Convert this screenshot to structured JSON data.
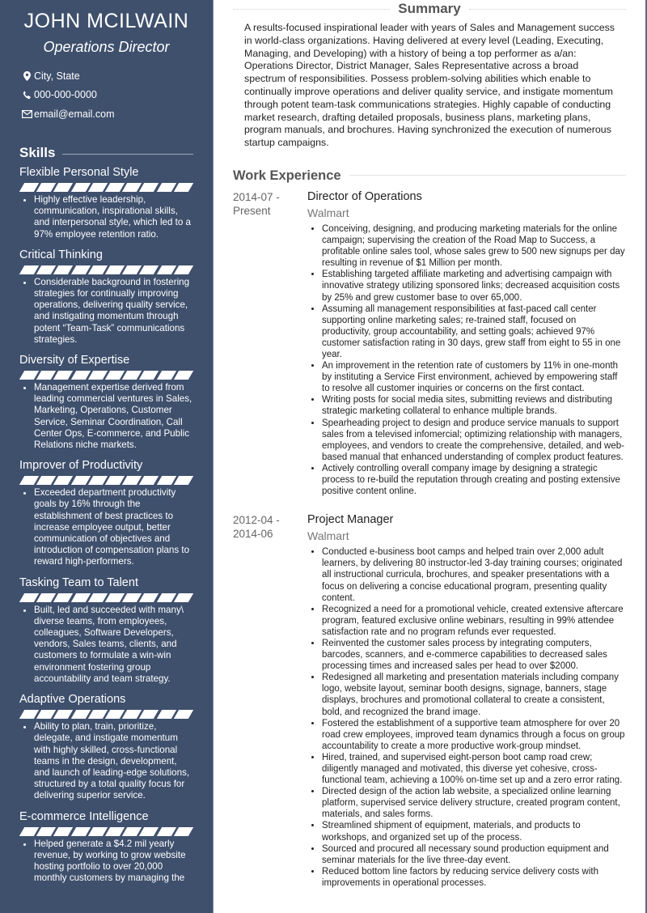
{
  "header": {
    "name": "JOHN MCILWAIN",
    "role": "Operations Director"
  },
  "contact": [
    {
      "icon": "location-pin-icon",
      "text": "City, State"
    },
    {
      "icon": "phone-icon",
      "text": "000-000-0000"
    },
    {
      "icon": "envelope-icon",
      "text": "email@email.com"
    }
  ],
  "skills": {
    "heading": "Skills",
    "bar_segments": 10,
    "items": [
      {
        "name": "Flexible Personal Style",
        "level": 10,
        "bullets": [
          "Highly effective leadership, communication, inspirational skills, and interpersonal style, which led to a 97% employee retention ratio."
        ]
      },
      {
        "name": "Critical Thinking",
        "level": 10,
        "bullets": [
          "Considerable background in fostering strategies for continually improving operations, delivering quality service, and instigating momentum through potent “Team-Task” communications strategies."
        ]
      },
      {
        "name": "Diversity of Expertise",
        "level": 10,
        "bullets": [
          "Management expertise derived from leading commercial ventures in Sales, Marketing, Operations, Customer Service, Seminar Coordination, Call Center Ops, E-commerce, and Public Relations niche markets."
        ]
      },
      {
        "name": "Improver of Productivity",
        "level": 10,
        "bullets": [
          "Exceeded department productivity goals by 16% through the establishment of best practices to increase employee output, better communication of objectives and introduction of compensation plans to reward high-performers."
        ]
      },
      {
        "name": "Tasking Team to Talent",
        "level": 10,
        "bullets": [
          "Built, led and succeeded with many\\ diverse teams, from employees, colleagues, Software Developers, vendors, Sales teams, clients, and customers to formulate a win-win environment fostering group accountability and team strategy."
        ]
      },
      {
        "name": "Adaptive Operations",
        "level": 10,
        "bullets": [
          "Ability to plan, train, prioritize, delegate, and instigate momentum with highly skilled, cross-functional teams in the design, development, and launch of leading-edge solutions, structured by a total quality focus for delivering superior service."
        ]
      },
      {
        "name": "E-commerce Intelligence",
        "level": 10,
        "bullets": [
          "Helped generate a $4.2 mil yearly revenue, by working to grow website hosting portfolio to over 20,000 monthly customers by managing the"
        ]
      }
    ]
  },
  "summary": {
    "heading": "Summary",
    "text": "A results-focused inspirational leader with years of Sales and Management success in world-class organizations. Having delivered at every level (Leading, Executing, Managing, and Developing) with a history of being a top performer as a/an: Operations Director, District Manager, Sales Representative across a broad spectrum of responsibilities. Possess problem-solving abilities which enable to continually improve operations and deliver quality service, and instigate momentum through potent team-task communications strategies. Highly capable of conducting market research, drafting detailed proposals, business plans, marketing plans, program manuals, and brochures. Having synchronized the execution of numerous startup campaigns."
  },
  "work": {
    "heading": "Work Experience",
    "jobs": [
      {
        "start": "2014-07 -",
        "end": "Present",
        "title": "Director of Operations",
        "company": "Walmart",
        "bullets": [
          "Conceiving, designing, and producing marketing materials for the online campaign; supervising the creation of the Road Map to Success, a profitable online sales tool, whose sales grew to 500 new signups per day resulting in revenue of $1 Million per month.",
          "Establishing targeted affiliate marketing and advertising campaign with innovative strategy utilizing sponsored links; decreased acquisition costs by 25% and grew customer base to over 65,000.",
          "Assuming all management responsibilities at fast-paced call center supporting online marketing sales; re-trained staff, focused on productivity, group accountability, and setting goals; achieved 97% customer satisfaction rating in 30 days, grew staff from eight to 55 in one year.",
          "An improvement in the retention rate of customers by 11% in one-month by instituting a Service First environment, achieved by empowering staff to resolve all customer inquiries or concerns on the first contact.",
          "Writing posts for social media sites, submitting reviews and distributing strategic marketing collateral to enhance multiple brands.",
          "Spearheading project to design and produce service manuals to support sales from a televised infomercial; optimizing relationship with managers, employees, and vendors to create the comprehensive, detailed, and web-based manual that enhanced understanding of complex product features.",
          "Actively controlling overall company image by designing a strategic process to re-build the reputation through creating and posting extensive positive content online."
        ]
      },
      {
        "start": "2012-04 -",
        "end": "2014-06",
        "title": "Project Manager",
        "company": "Walmart",
        "bullets": [
          "Conducted e-business boot camps and helped train over 2,000 adult learners, by delivering 80 instructor-led 3-day training courses; originated all instructional curricula, brochures, and speaker presentations with a focus on delivering a concise educational program, presenting quality content.",
          "Recognized a need for a promotional vehicle, created extensive aftercare program, featured exclusive online webinars, resulting in 99% attendee satisfaction rate and no program refunds ever requested.",
          "Reinvented the customer sales process by integrating computers, barcodes, scanners, and e-commerce capabilities to decreased sales processing times and increased sales per head to over $2000.",
          "Redesigned all marketing and presentation materials including company logo, website layout, seminar booth designs, signage, banners, stage displays, brochures and promotional collateral to create a consistent, bold, and recognized the brand image.",
          "Fostered the establishment of a supportive team atmosphere for over 20 road crew employees, improved team dynamics through a focus on group accountability to create a more productive work-group mindset.",
          "Hired, trained, and supervised eight-person boot camp road crew; diligently managed and motivated, this diverse yet cohesive, cross-functional team, achieving a 100% on-time set up and a zero error rating.",
          "Directed design of the action lab website, a specialized online learning platform, supervised service delivery structure, created program content, materials, and sales forms.",
          "Streamlined shipment of equipment, materials, and products to workshops, and organized set up of the process.",
          "Sourced and procured all necessary sound production equipment and seminar materials for the live three-day event.",
          "Reduced bottom line factors by reducing service delivery costs with improvements in operational processes."
        ]
      }
    ]
  },
  "colors": {
    "sidebar_bg": "#3f506d",
    "sidebar_text": "#ffffff",
    "heading_gray": "#555555",
    "muted_gray": "#777777"
  }
}
